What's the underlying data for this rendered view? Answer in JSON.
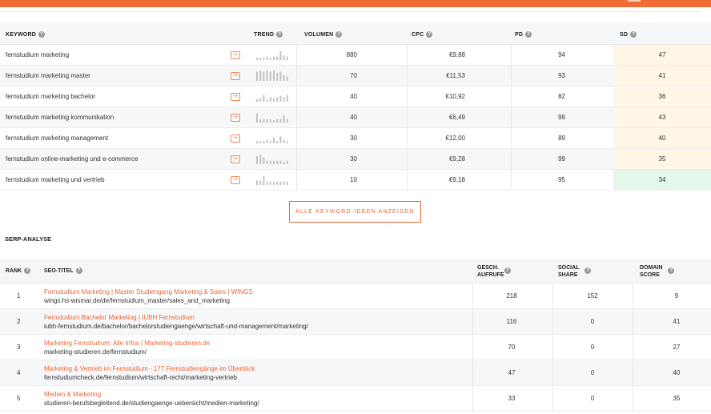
{
  "keywords_table": {
    "headers": {
      "keyword": "KEYWORD",
      "trend": "TREND",
      "volume": "VOLUMEN",
      "cpc": "CPC",
      "pd": "PD",
      "sd": "SD"
    },
    "rows": [
      {
        "keyword": "fernstudium marketing",
        "trend": [
          2,
          2,
          2,
          3,
          2,
          3,
          3,
          8,
          4,
          3
        ],
        "volume": "880",
        "cpc": "€9,88",
        "pd": "94",
        "sd": "47",
        "sd_color": "#fff6e6"
      },
      {
        "keyword": "fernstudium marketing master",
        "trend": [
          8,
          9,
          8,
          9,
          8,
          9,
          7,
          8,
          5,
          4
        ],
        "volume": "70",
        "cpc": "€11,53",
        "pd": "93",
        "sd": "41",
        "sd_color": "#fff6e6"
      },
      {
        "keyword": "fernstudium marketing bachelor",
        "trend": [
          2,
          3,
          6,
          2,
          4,
          3,
          4,
          5,
          4,
          6
        ],
        "volume": "40",
        "cpc": "€10,92",
        "pd": "82",
        "sd": "36",
        "sd_color": "#fff6e6"
      },
      {
        "keyword": "fernstudium marketing kommunikation",
        "trend": [
          8,
          3,
          3,
          3,
          3,
          2,
          3,
          3,
          6,
          3
        ],
        "volume": "40",
        "cpc": "€6,49",
        "pd": "99",
        "sd": "43",
        "sd_color": "#fff6e6"
      },
      {
        "keyword": "fernstudium marketing management",
        "trend": [
          2,
          2,
          2,
          3,
          2,
          5,
          2,
          6,
          3,
          2
        ],
        "volume": "30",
        "cpc": "€12,00",
        "pd": "89",
        "sd": "40",
        "sd_color": "#fff6e6"
      },
      {
        "keyword": "fernstudium online-marketing und e-commerce",
        "trend": [
          7,
          8,
          6,
          3,
          3,
          3,
          3,
          3,
          2,
          3
        ],
        "volume": "30",
        "cpc": "€9,28",
        "pd": "99",
        "sd": "35",
        "sd_color": "#fff6e6"
      },
      {
        "keyword": "fernstudium marketing und vertrieb",
        "trend": [
          4,
          4,
          8,
          3,
          3,
          3,
          3,
          3,
          3,
          3
        ],
        "volume": "10",
        "cpc": "€9,18",
        "pd": "95",
        "sd": "34",
        "sd_color": "#e3f7ea"
      }
    ],
    "more_button": "ALLE KEYWORD-IDEEN ANZEIGEN"
  },
  "serp": {
    "title": "SERP-ANALYSE",
    "headers": {
      "rank": "RANK",
      "seo_title": "SEO-TITEL",
      "views_line1": "GESCH.",
      "views_line2": "AUFRUFE",
      "social_line1": "SOCIAL",
      "social_line2": "SHARE",
      "domain_line1": "DOMAIN",
      "domain_line2": "SCORE"
    },
    "rows": [
      {
        "rank": "1",
        "title": "Fernstudium Marketing | Master Studiengang Marketing & Sales | WINGS",
        "url": "wings.hs-wismar.de/de/fernstudium_master/sales_and_marketing",
        "views": "218",
        "social": "152",
        "domain": "9"
      },
      {
        "rank": "2",
        "title": "Fernstudium Bachelor Marketing | IUBH Fernstudium",
        "url": "iubh-fernstudium.de/bachelor/bachelorstudiengaenge/wirtschaft-und-management/marketing/",
        "views": "116",
        "social": "0",
        "domain": "41"
      },
      {
        "rank": "3",
        "title": "Marketing Fernstudium: Alle Infos | Marketing-studieren.de",
        "url": "marketing-studieren.de/fernstudium/",
        "views": "70",
        "social": "0",
        "domain": "27"
      },
      {
        "rank": "4",
        "title": "Marketing & Vertrieb im Fernstudium - 177 Fernstudiengänge im Überblick",
        "url": "fernstudiumcheck.de/fernstudium/wirtschaft-recht/marketing-vertrieb",
        "views": "47",
        "social": "0",
        "domain": "40"
      },
      {
        "rank": "5",
        "title": "Medien & Marketing",
        "url": "studieren-berufsbegleitend.de/studiengaenge-uebersicht/medien-marketing/",
        "views": "33",
        "social": "0",
        "domain": "35"
      }
    ]
  },
  "icons": {
    "help": "question-circle-icon",
    "open": "external-arrow-icon"
  },
  "colors": {
    "brand": "#f26a36",
    "link": "#e8683a",
    "trend_bar": "#c4c4c4"
  }
}
